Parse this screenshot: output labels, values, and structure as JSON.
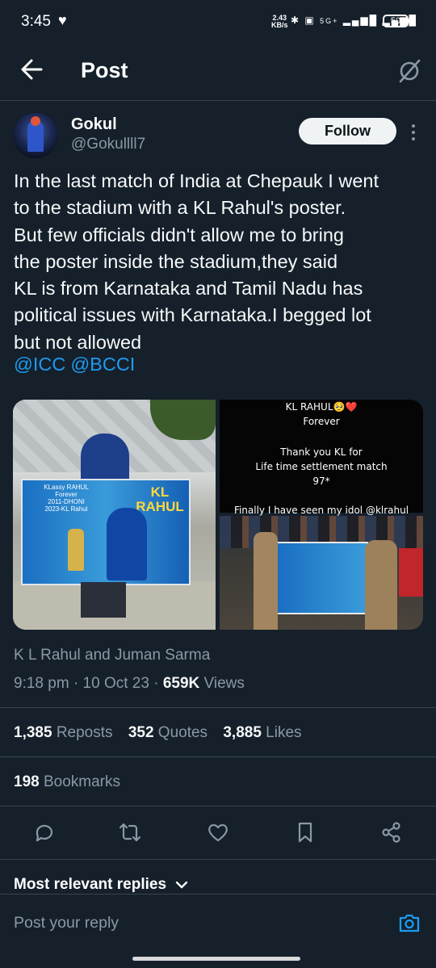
{
  "status_bar": {
    "time": "3:45",
    "net_speed": "2.43",
    "net_unit": "KB/s",
    "network": "5G+",
    "battery": "50"
  },
  "header": {
    "title": "Post"
  },
  "author": {
    "name": "Gokul",
    "handle": "@Gokullll7",
    "follow_label": "Follow"
  },
  "tweet": {
    "lines": [
      "In the last match of India at Chepauk I went",
      "to the stadium with a KL Rahul's poster.",
      "But few officials didn't allow me to bring",
      "the poster inside the stadium,they said",
      "KL is from Karnataka and Tamil Nadu has",
      "political issues with Karnataka.I begged lot",
      "but not allowed"
    ],
    "mentions": [
      "@ICC",
      "@BCCI"
    ]
  },
  "media": {
    "image1": {
      "banner_line1": "KLassy RAHUL",
      "banner_line2": "Forever",
      "banner_line3": "2011-DHONI",
      "banner_line4": "2023-KL Rahul",
      "banner_big": "KL RAHUL"
    },
    "image2": {
      "line1": "KL RAHUL🥺❤️",
      "line2": "Forever",
      "line3": "Thank you KL for",
      "line4": "Life time settlement match",
      "line5": "97*",
      "line6": "Finally I have seen my idol @klrahul"
    }
  },
  "meta": {
    "attribution": "K L Rahul and Juman Sarma",
    "time_date": "9:18 pm · 10 Oct 23 · ",
    "views_count": "659K",
    "views_label": " Views"
  },
  "stats": {
    "reposts_count": "1,385",
    "reposts_label": "Reposts",
    "quotes_count": "352",
    "quotes_label": "Quotes",
    "likes_count": "3,885",
    "likes_label": "Likes",
    "bookmarks_count": "198",
    "bookmarks_label": "Bookmarks"
  },
  "replies": {
    "sort_label": "Most relevant replies",
    "placeholder": "Post your reply"
  },
  "colors": {
    "background": "#15202b",
    "accent": "#1d9bf0",
    "muted": "#8b98a5"
  },
  "icons": [
    "back-arrow-icon",
    "grok-icon",
    "more-icon",
    "reply-icon",
    "repost-icon",
    "like-icon",
    "bookmark-icon",
    "share-icon",
    "camera-icon",
    "chevron-down-icon"
  ]
}
